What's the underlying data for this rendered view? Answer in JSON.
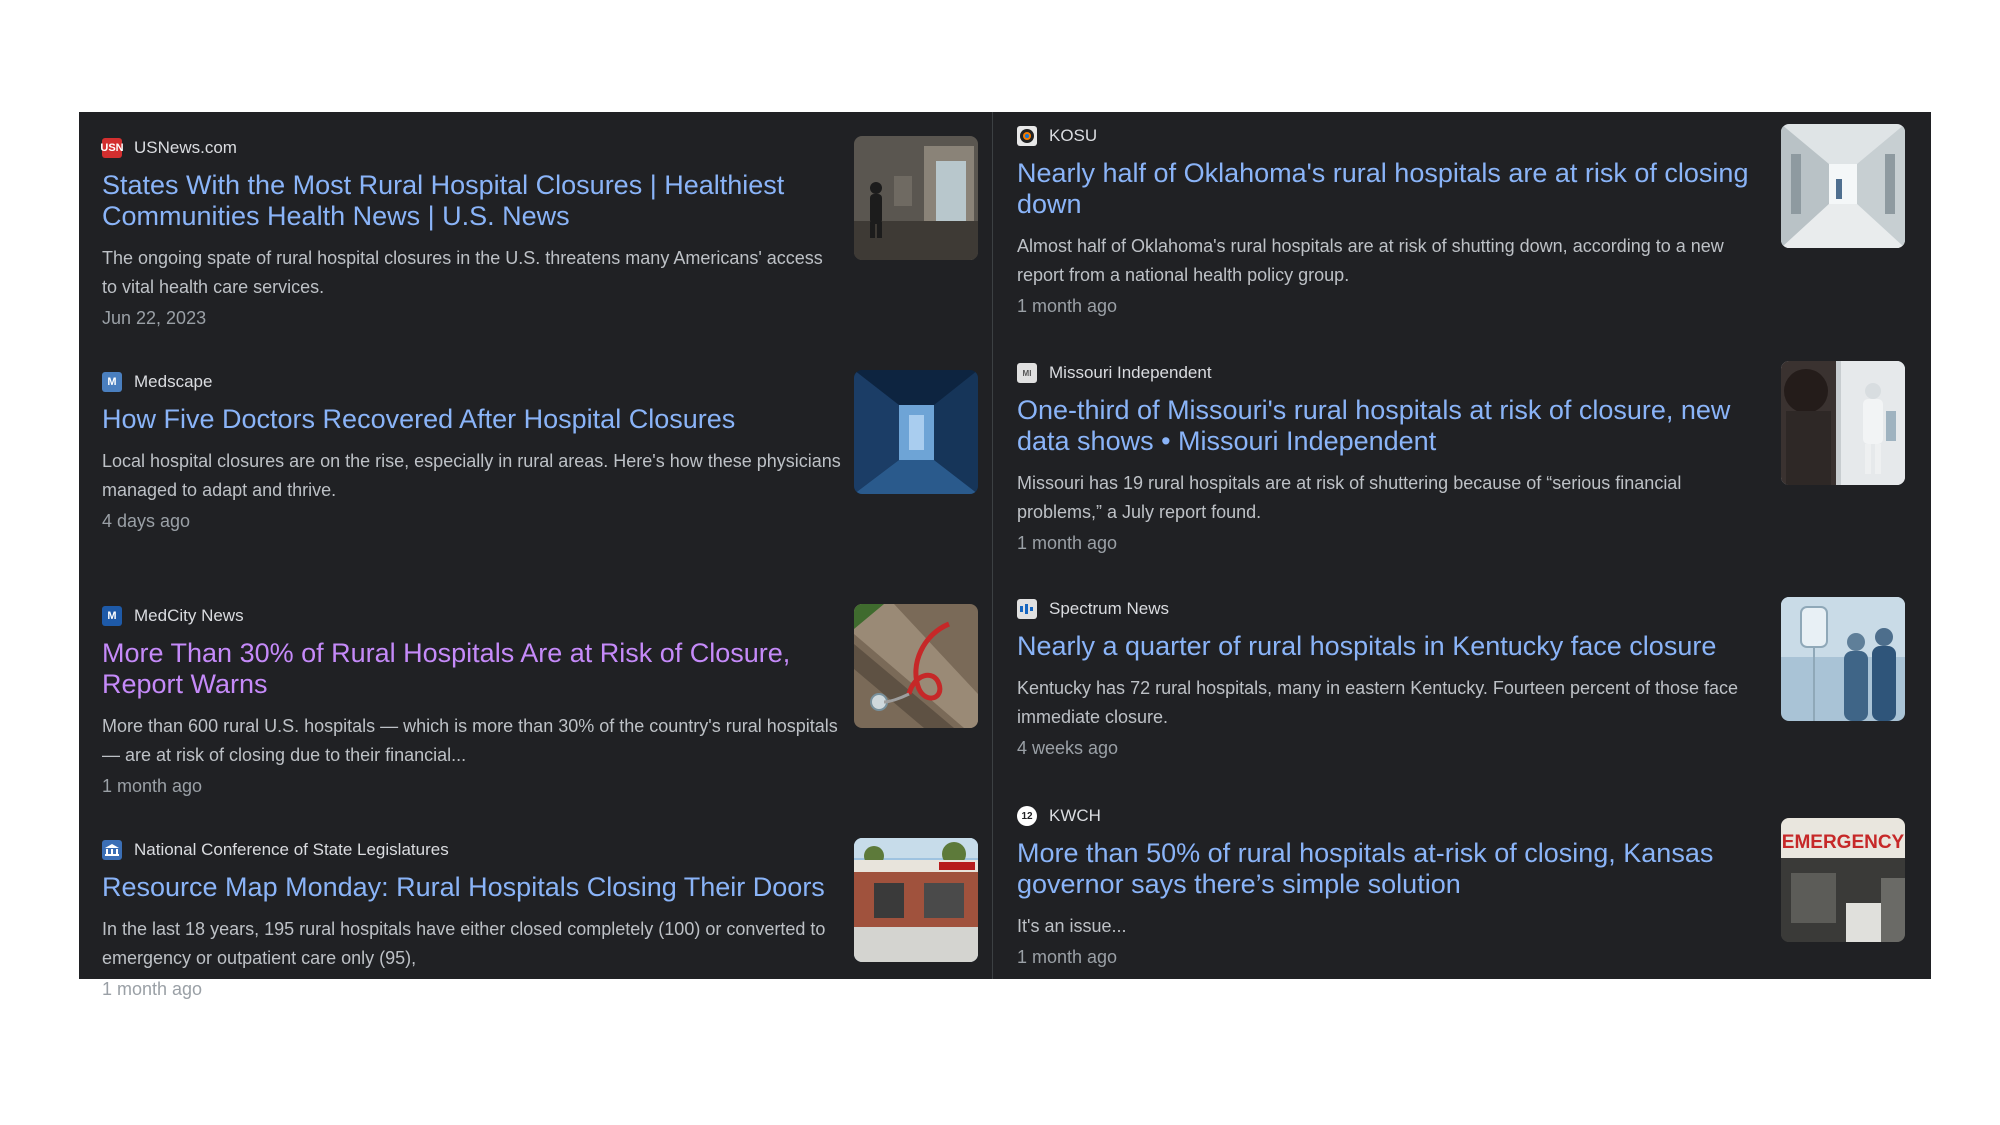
{
  "left_column": [
    {
      "source": "USNews.com",
      "favicon_text": "USN",
      "favicon_color": "#d32f2f",
      "headline": "States With the Most Rural Hospital Closures | Healthiest Communities Health News | U.S. News",
      "snippet": "The ongoing spate of rural hospital closures in the U.S. threatens many Americans' access to vital health care services.",
      "date": "Jun 22, 2023",
      "thumbnail": "hospital-corridor-person-walking"
    },
    {
      "source": "Medscape",
      "favicon_text": "M",
      "favicon_color": "#4a7fbf",
      "headline": "How Five Doctors Recovered After Hospital Closures",
      "snippet": "Local hospital closures are on the rise, especially in rural areas. Here's how these physicians managed to adapt and thrive.",
      "date": "4 days ago",
      "thumbnail": "dark-blue-hallway"
    },
    {
      "source": "MedCity News",
      "favicon_text": "M",
      "favicon_color": "#1e5aa8",
      "headline": "More Than 30% of Rural Hospitals Are at Risk of Closure, Report Warns",
      "snippet": "More than 600 rural U.S. hospitals — which is more than 30% of the country's rural hospitals — are at risk of closing due to their financial...",
      "date": "1 month ago",
      "thumbnail": "red-stethoscope-on-wood"
    },
    {
      "source": "National Conference of State Legislatures",
      "favicon_text": "",
      "favicon_color": "#3b6fb6",
      "headline": "Resource Map Monday: Rural Hospitals Closing Their Doors",
      "snippet": "In the last 18 years, 195 rural hospitals have either closed completely (100) or converted to emergency or outpatient care only (95),",
      "date": "1 month ago",
      "thumbnail": "emergency-building-exterior"
    }
  ],
  "right_column": [
    {
      "source": "KOSU",
      "favicon_text": "",
      "favicon_color": "#e8e8e8",
      "headline": "Nearly half of Oklahoma's rural hospitals are at risk of closing down",
      "snippet": "Almost half of Oklahoma's rural hospitals are at risk of shutting down, according to a new report from a national health policy group.",
      "date": "1 month ago",
      "thumbnail": "bright-hospital-hallway"
    },
    {
      "source": "Missouri Independent",
      "favicon_text": "MI",
      "favicon_color": "#e0e0e0",
      "headline": "One-third of Missouri's rural hospitals at risk of closure, new data shows • Missouri Independent",
      "snippet": "Missouri has 19 rural hospitals are at risk of shuttering because of “serious financial problems,” a July report found.",
      "date": "1 month ago",
      "thumbnail": "hospital-staff-in-corridor"
    },
    {
      "source": "Spectrum News",
      "favicon_text": "",
      "favicon_color": "#e0e0e0",
      "headline": "Nearly a quarter of rural hospitals in Kentucky face closure",
      "snippet": "Kentucky has 72 rural hospitals, many in eastern Kentucky. Fourteen percent of those face immediate closure.",
      "date": "4 weeks ago",
      "thumbnail": "iv-bag-blurred-nurses"
    },
    {
      "source": "KWCH",
      "favicon_text": "12",
      "favicon_color": "#ffffff",
      "headline": "More than 50% of rural hospitals at-risk of closing, Kansas governor says there’s simple solution",
      "snippet": "It's an issue...",
      "date": "1 month ago",
      "thumbnail": "emergency-entrance-sign",
      "thumbnail_sign_text": "EMERGENCY"
    }
  ]
}
